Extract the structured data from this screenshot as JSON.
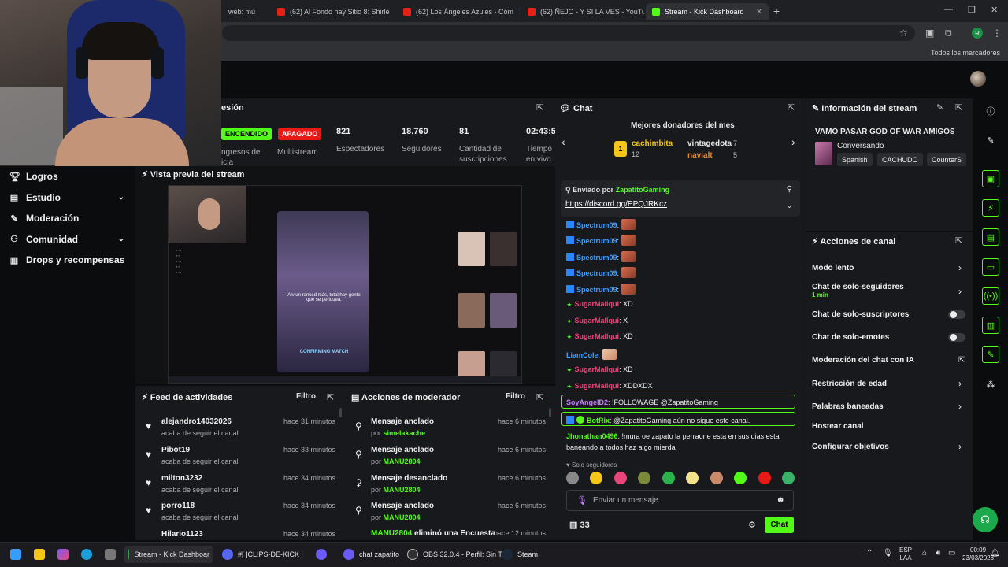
{
  "browser": {
    "tabs": [
      {
        "label": "web: mú"
      },
      {
        "label": "(62) Al Fondo hay Sitio 8: Shirle"
      },
      {
        "label": "(62) Los Ángeles Azules - Cóm"
      },
      {
        "label": "(62) ÑEJO - Y SI LA VES - YouTu"
      },
      {
        "label": "Stream - Kick Dashboard"
      }
    ],
    "new_tab": "+",
    "bookmarks_label": "Todos los marcadores",
    "profile_initial": "R",
    "colors": {
      "accent": "#53fc18",
      "youtube": "#e62117"
    }
  },
  "leftnav": {
    "items": [
      {
        "label": "Logros",
        "icon": "trophy-icon"
      },
      {
        "label": "Estudio",
        "icon": "studio-icon"
      },
      {
        "label": "Moderación",
        "icon": "wrench-icon"
      },
      {
        "label": "Comunidad",
        "icon": "community-icon"
      },
      {
        "label": "Drops y recompensas",
        "icon": "gift-icon"
      }
    ]
  },
  "session": {
    "title": "esión",
    "status_on": "ENCENDIDO",
    "status_off": "APAGADO",
    "ingresos_label": "ngresos de",
    "ingresos_label2": "icia",
    "multistream_label": "Multistream",
    "viewers": "821",
    "viewers_label": "Espectadores",
    "followers": "18.760",
    "followers_label": "Seguidores",
    "subs": "81",
    "subs_label": "Cantidad de",
    "subs_label2": "suscripciones",
    "uptime": "02:43:5",
    "uptime_label": "Tiempo",
    "uptime_label2": "en vivo"
  },
  "preview": {
    "title": "Vista previa del stream",
    "phone_caption": "Alv un ranked más, total,hay gente que se periquea.",
    "phone_footer": "CONFIRMING MATCH"
  },
  "feed": {
    "title": "Feed de actividades",
    "filter": "Filtro",
    "items": [
      {
        "name": "alejandro14032026",
        "sub": "acaba de seguir el canal",
        "time": "hace 31 minutos"
      },
      {
        "name": "Pibot19",
        "sub": "acaba de seguir el canal",
        "time": "hace 33 minutos"
      },
      {
        "name": "milton3232",
        "sub": "acaba de seguir el canal",
        "time": "hace 34 minutos"
      },
      {
        "name": "porro118",
        "sub": "acaba de seguir el canal",
        "time": "hace 34 minutos"
      },
      {
        "name": "Hilario1123",
        "sub": "",
        "time": "hace 34 minutos"
      }
    ]
  },
  "mod": {
    "title": "Acciones de moderador",
    "filter": "Filtro",
    "items": [
      {
        "action": "Mensaje anclado",
        "by_prefix": "por",
        "by": "simelakache",
        "time": "hace 6 minutos"
      },
      {
        "action": "Mensaje anclado",
        "by_prefix": "por",
        "by": "MANU2804",
        "time": "hace 6 minutos"
      },
      {
        "action": "Mensaje desanclado",
        "by_prefix": "por",
        "by": "MANU2804",
        "time": "hace 6 minutos"
      },
      {
        "action": "Mensaje anclado",
        "by_prefix": "por",
        "by": "MANU2804",
        "time": "hace 6 minutos"
      }
    ],
    "last_user": "MANU2804",
    "last_action": "eliminó una Encuesta",
    "last_time": "hace 12 minutos"
  },
  "chat": {
    "title": "Chat",
    "donors_title": "Mejores donadores del mes",
    "donor1": "cachimbita",
    "donor1_amt": "12",
    "donor2": "vintagedota",
    "donor2_amt": "7",
    "donor3": "navialt",
    "donor3_amt": "5",
    "pinned_prefix": "Enviado por",
    "pinned_by": "ZapatitoGaming",
    "pinned_link": "https://discord.gg/EPQJRKcz",
    "spectrum": "Spectrum09",
    "sugar": "SugarMallqui",
    "sugar_msgs": [
      "XD",
      "X",
      "XD",
      "XD",
      "XDDXDX"
    ],
    "liam": "LiamCole",
    "soy": "SoyAngelD2",
    "soy_msg": "!FOLLOWAGE @ZapatitoGaming",
    "botrix": "BotRix",
    "botrix_msg": "@ZapatitoGaming aún no sigue este canal.",
    "jho": "Jhonathan0496",
    "jho_msg": "!mura oe zapato la perraone esta en sus dias esta",
    "jho_msg2": "baneando a todos haz algo mierda",
    "solo": "Solo seguidores",
    "placeholder": "Enviar un mensaje",
    "points": "33",
    "send": "Chat"
  },
  "info": {
    "title": "Información del stream",
    "stream_title": "VAMO PASAR GOD OF WAR AMIGOS",
    "category": "Conversando",
    "tags": [
      "Spanish",
      "CACHUDO",
      "CounterS"
    ]
  },
  "actions": {
    "title": "Acciones de canal",
    "rows": [
      {
        "label": "Modo lento",
        "sub": "",
        "control": "chevron"
      },
      {
        "label": "Chat de solo-seguidores",
        "sub": "1 min",
        "control": "chevron"
      },
      {
        "label": "Chat de solo-suscriptores",
        "sub": "",
        "control": "toggle"
      },
      {
        "label": "Chat de solo-emotes",
        "sub": "",
        "control": "toggle"
      },
      {
        "label": "Moderación del chat con IA",
        "sub": "",
        "control": "external"
      },
      {
        "label": "Restricción de edad",
        "sub": "",
        "control": "chevron"
      },
      {
        "label": "Palabras baneadas",
        "sub": "",
        "control": "chevron"
      },
      {
        "label": "Hostear canal",
        "sub": "",
        "control": "none"
      },
      {
        "label": "Configurar objetivos",
        "sub": "",
        "control": "chevron"
      }
    ]
  },
  "taskbar": {
    "items": [
      {
        "label": "Stream - Kick Dashboar"
      },
      {
        "label": "#[ ]CLIPS-DE-KICK | "
      },
      {
        "label": "chat zapatito"
      },
      {
        "label": "OBS 32.0.4 - Perfil: Sin T"
      },
      {
        "label": "Steam"
      }
    ],
    "lang": "ESP",
    "lang2": "LAA",
    "time": "00:09",
    "date": "23/03/2026"
  }
}
